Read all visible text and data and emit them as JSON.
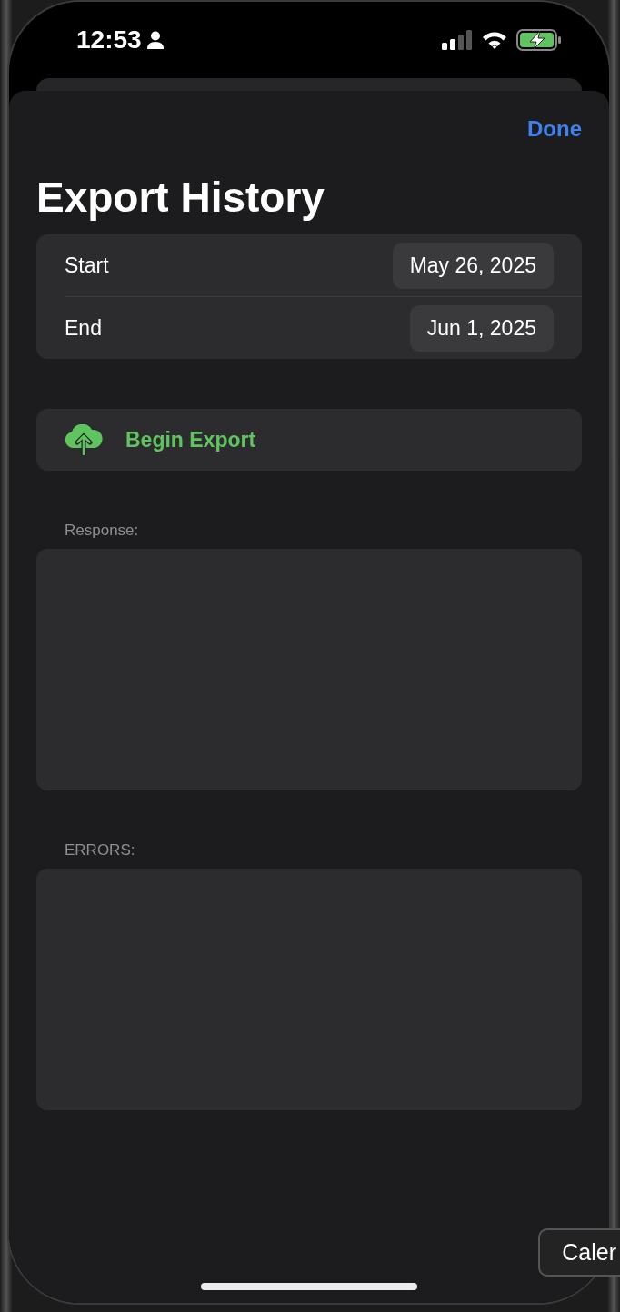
{
  "status_bar": {
    "time": "12:53"
  },
  "sheet": {
    "done": "Done",
    "title": "Export History"
  },
  "dates": [
    {
      "label": "Start",
      "value": "May 26, 2025"
    },
    {
      "label": "End",
      "value": "Jun 1, 2025"
    }
  ],
  "export_button": {
    "label": "Begin Export"
  },
  "sections": [
    {
      "label": "Response:"
    },
    {
      "label": "ERRORS:"
    }
  ],
  "tooltip": {
    "text": "Caler"
  }
}
